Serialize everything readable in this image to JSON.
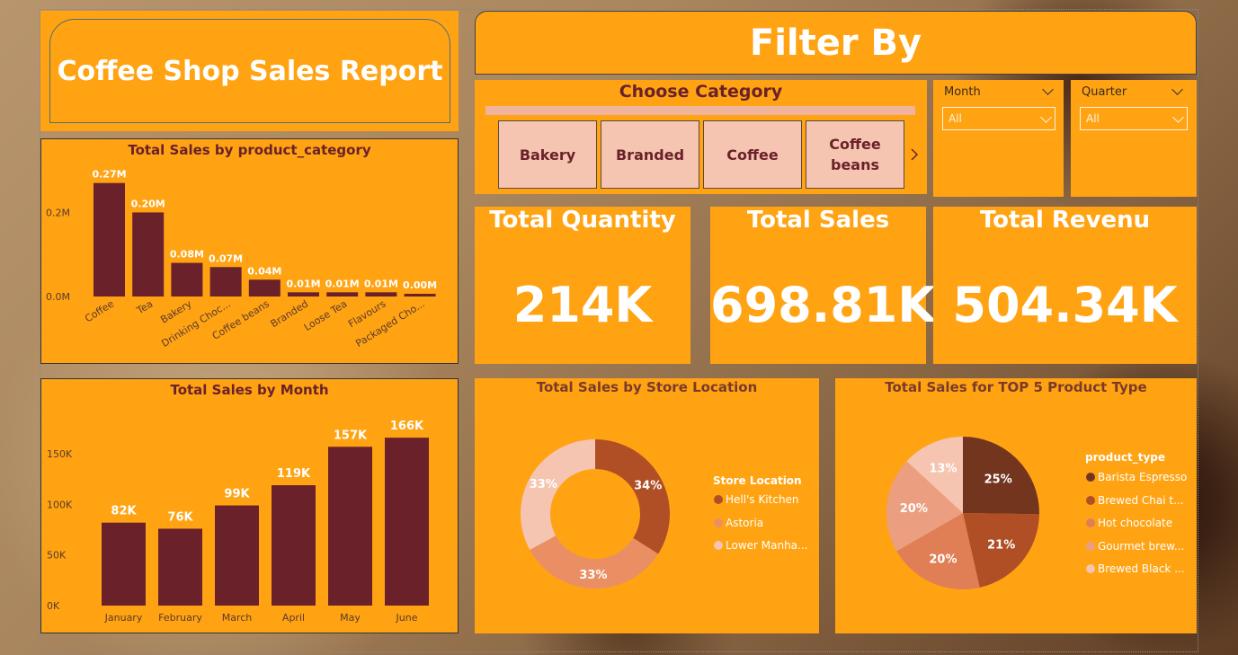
{
  "report_title": "Coffee Shop Sales Report",
  "filter_title": "Filter By",
  "category_slicer": {
    "title": "Choose Category",
    "buttons": [
      "Bakery",
      "Branded",
      "Coffee",
      "Coffee\nbeans"
    ]
  },
  "month_slicer": {
    "label": "Month",
    "value": "All"
  },
  "quarter_slicer": {
    "label": "Quarter",
    "value": "All"
  },
  "kpis": [
    {
      "title": "Total Quantity",
      "value": "214K"
    },
    {
      "title": "Total Sales",
      "value": "698.81K"
    },
    {
      "title": "Total Revenu",
      "value": "504.34K"
    }
  ],
  "colors": {
    "panel": "#ffa313",
    "bar": "#6b2129",
    "white": "#ffffff"
  },
  "chart_data": [
    {
      "type": "bar",
      "title": "Total Sales by product_category",
      "categories": [
        "Coffee",
        "Tea",
        "Bakery",
        "Drinking Choc...",
        "Coffee beans",
        "Branded",
        "Loose Tea",
        "Flavours",
        "Packaged Cho..."
      ],
      "values": [
        0.27,
        0.2,
        0.08,
        0.07,
        0.04,
        0.01,
        0.01,
        0.01,
        0.0
      ],
      "data_labels": [
        "0.27M",
        "0.20M",
        "0.08M",
        "0.07M",
        "0.04M",
        "0.01M",
        "0.01M",
        "0.01M",
        "0.00M"
      ],
      "y_ticks": [
        "0.0M",
        "0.2M"
      ],
      "y_tick_values": [
        0,
        0.2
      ],
      "ylim": [
        0,
        0.28
      ],
      "xlabel": "",
      "ylabel": ""
    },
    {
      "type": "bar",
      "title": "Total Sales by Month",
      "categories": [
        "January",
        "February",
        "March",
        "April",
        "May",
        "June"
      ],
      "values": [
        82,
        76,
        99,
        119,
        157,
        166
      ],
      "data_labels": [
        "82K",
        "76K",
        "99K",
        "119K",
        "157K",
        "166K"
      ],
      "y_ticks": [
        "0K",
        "50K",
        "100K",
        "150K"
      ],
      "y_tick_values": [
        0,
        50,
        100,
        150
      ],
      "ylim": [
        0,
        175
      ],
      "xlabel": "",
      "ylabel": ""
    },
    {
      "type": "pie",
      "title": "Total Sales by Store Location",
      "donut": true,
      "legend_title": "Store Location",
      "categories": [
        "Hell's Kitchen",
        "Astoria",
        "Lower Manha..."
      ],
      "values": [
        34,
        33,
        33
      ],
      "data_labels": [
        "34%",
        "33%",
        "33%"
      ],
      "colors": [
        "#b04f25",
        "#ea8f64",
        "#f5c5b2"
      ]
    },
    {
      "type": "pie",
      "title": "Total Sales for TOP 5 Product Type",
      "donut": false,
      "legend_title": "product_type",
      "categories": [
        "Barista Espresso",
        "Brewed Chai t...",
        "Hot chocolate",
        "Gourmet brew...",
        "Brewed Black ..."
      ],
      "values": [
        25,
        21,
        20,
        20,
        13
      ],
      "data_labels": [
        "25%",
        "21%",
        "20%",
        "20%",
        "13%"
      ],
      "colors": [
        "#74351f",
        "#b04f25",
        "#e07e55",
        "#eb9f80",
        "#f5c5b2"
      ]
    }
  ]
}
